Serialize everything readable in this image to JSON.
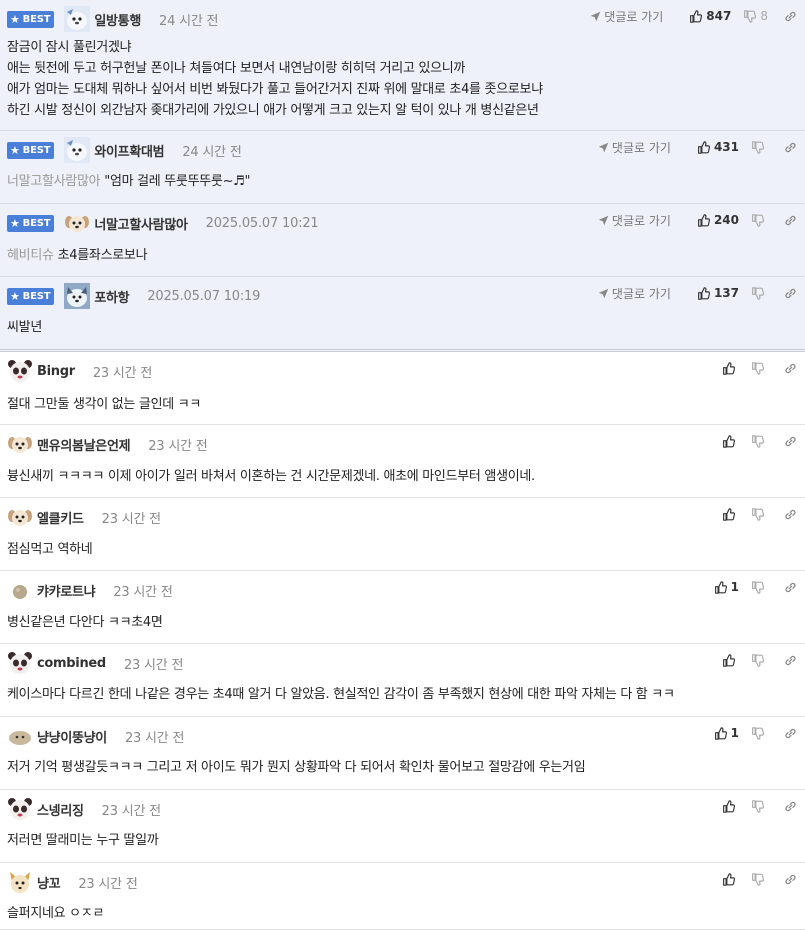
{
  "colors": {
    "best_badge": "#4a7fd9",
    "best_row_bg": "#eef1f9",
    "time": "#888888",
    "mention": "#999999"
  },
  "labels": {
    "best": "BEST",
    "reply_to": "댓글로 가기"
  },
  "comments": [
    {
      "best": true,
      "avatar": "seal",
      "nick": "일방통행",
      "time": "24 시간 전",
      "reply_link": true,
      "up": "847",
      "down": "8",
      "mention": "",
      "lines": [
        "잠금이 잠시 풀린거겠냐",
        "애는 뒷전에 두고 허구헌날 폰이나 쳐들여다 보면서 내연남이랑 히히덕 거리고 있으니까",
        "애가 엄마는 도대체 뭐하나 싶어서 비번 봐뒀다가 풀고 들어간거지 진짜 위에 말대로 초4를 좃으로보냐",
        "하긴 시발 정신이 외간남자 좆대가리에 가있으니 애가 어떻게 크고 있는지 알 턱이 있나 개 병신같은년"
      ]
    },
    {
      "best": true,
      "avatar": "seal",
      "nick": "와이프확대범",
      "time": "24 시간 전",
      "reply_link": true,
      "up": "431",
      "down": "",
      "mention": "너말고할사람많아",
      "lines": [
        "\"엄마 걸레 뚜룻뚜뚜룻~♬\""
      ]
    },
    {
      "best": true,
      "avatar": "dog",
      "nick": "너말고할사람많아",
      "time": "2025.05.07 10:21",
      "reply_link": true,
      "up": "240",
      "down": "",
      "mention": "헤비티슈",
      "lines": [
        "초4를좌스로보나"
      ]
    },
    {
      "best": true,
      "avatar": "husky",
      "nick": "포하항",
      "time": "2025.05.07 10:19",
      "reply_link": true,
      "up": "137",
      "down": "",
      "mention": "",
      "lines": [
        "씨발년"
      ]
    },
    {
      "best": false,
      "avatar": "panda",
      "nick": "Bingr",
      "time": "23 시간 전",
      "reply_link": false,
      "up": "",
      "down": "",
      "mention": "",
      "lines": [
        "절대 그만둘 생각이 없는 글인데 ㅋㅋ"
      ]
    },
    {
      "best": false,
      "avatar": "dog",
      "nick": "맨유의봄날은언제",
      "time": "23 시간 전",
      "reply_link": false,
      "up": "",
      "down": "",
      "mention": "",
      "lines": [
        "븅신새끼 ㅋㅋㅋㅋ 이제 아이가 일러 바쳐서 이혼하는 건 시간문제겠네. 애초에 마인드부터 앰생이네."
      ]
    },
    {
      "best": false,
      "avatar": "dog",
      "nick": "엘클키드",
      "time": "23 시간 전",
      "reply_link": false,
      "up": "",
      "down": "",
      "mention": "",
      "lines": [
        "점심먹고 역하네"
      ]
    },
    {
      "best": false,
      "avatar": "stone",
      "nick": "캬캬로트냐",
      "time": "23 시간 전",
      "reply_link": false,
      "up": "1",
      "down": "",
      "mention": "",
      "lines": [
        "병신같은년 다안다 ㅋㅋ초4면"
      ]
    },
    {
      "best": false,
      "avatar": "panda",
      "nick": "combined",
      "time": "23 시간 전",
      "reply_link": false,
      "up": "",
      "down": "",
      "mention": "",
      "lines": [
        "케이스마다 다르긴 한데 나같은 경우는 초4때 알거 다 알았음. 현실적인 감각이 좀 부족했지 현상에 대한 파악 자체는 다 함 ㅋㅋ"
      ]
    },
    {
      "best": false,
      "avatar": "blob",
      "nick": "냥냥이뚱냥이",
      "time": "23 시간 전",
      "reply_link": false,
      "up": "1",
      "down": "",
      "mention": "",
      "lines": [
        "저거 기억 평생갈듯ㅋㅋㅋ 그리고 저 아이도 뭐가 뭔지 상황파악 다 되어서 확인차 물어보고 절망감에 우는거임"
      ]
    },
    {
      "best": false,
      "avatar": "panda",
      "nick": "스넹리징",
      "time": "23 시간 전",
      "reply_link": false,
      "up": "",
      "down": "",
      "mention": "",
      "lines": [
        "저러면 딸래미는 누구 딸일까"
      ]
    },
    {
      "best": false,
      "avatar": "fox",
      "nick": "냥꼬",
      "time": "23 시간 전",
      "reply_link": false,
      "up": "",
      "down": "",
      "mention": "",
      "lines": [
        "슬퍼지네요 ㅇㅈㄹ"
      ]
    }
  ]
}
